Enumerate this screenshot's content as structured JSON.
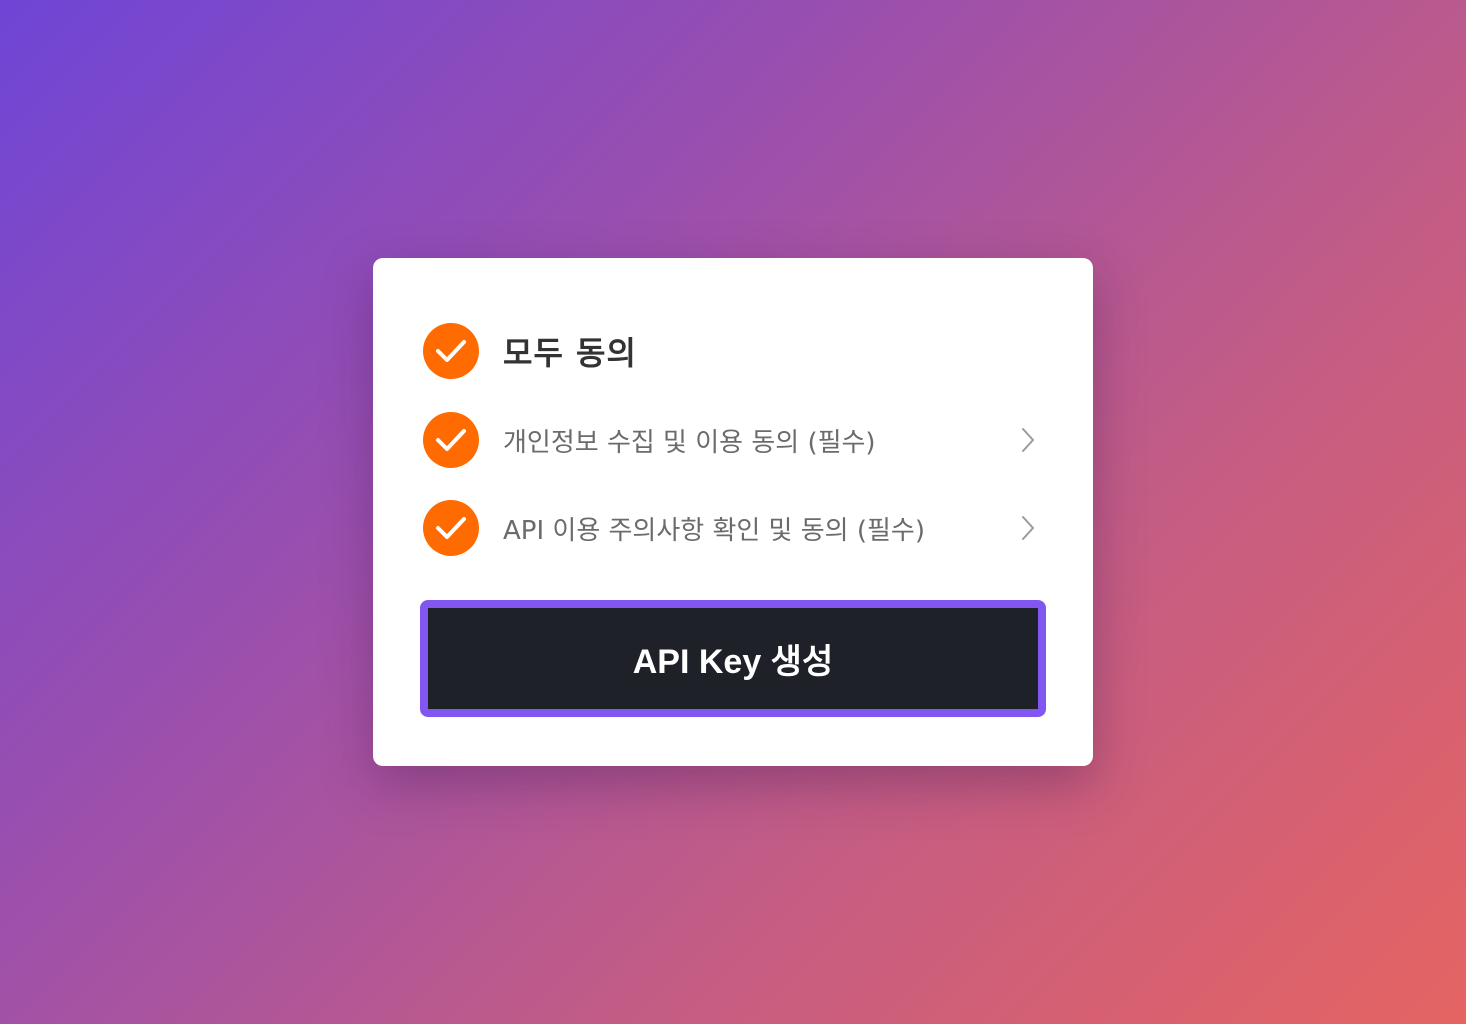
{
  "colors": {
    "check": "#ff6b00",
    "button_bg": "#1e2128",
    "button_border": "#8256f0",
    "background_start": "#6f45d6",
    "background_end": "#e56462"
  },
  "agreement": {
    "all": {
      "label": "모두 동의",
      "checked": true,
      "icon": "check-icon"
    },
    "items": [
      {
        "label": "개인정보 수집 및 이용 동의 (필수)",
        "checked": true,
        "icon": "check-icon",
        "chevron": "chevron-right-icon"
      },
      {
        "label": "API 이용 주의사항 확인 및 동의 (필수)",
        "checked": true,
        "icon": "check-icon",
        "chevron": "chevron-right-icon"
      }
    ]
  },
  "cta": {
    "label": "API Key 생성"
  }
}
